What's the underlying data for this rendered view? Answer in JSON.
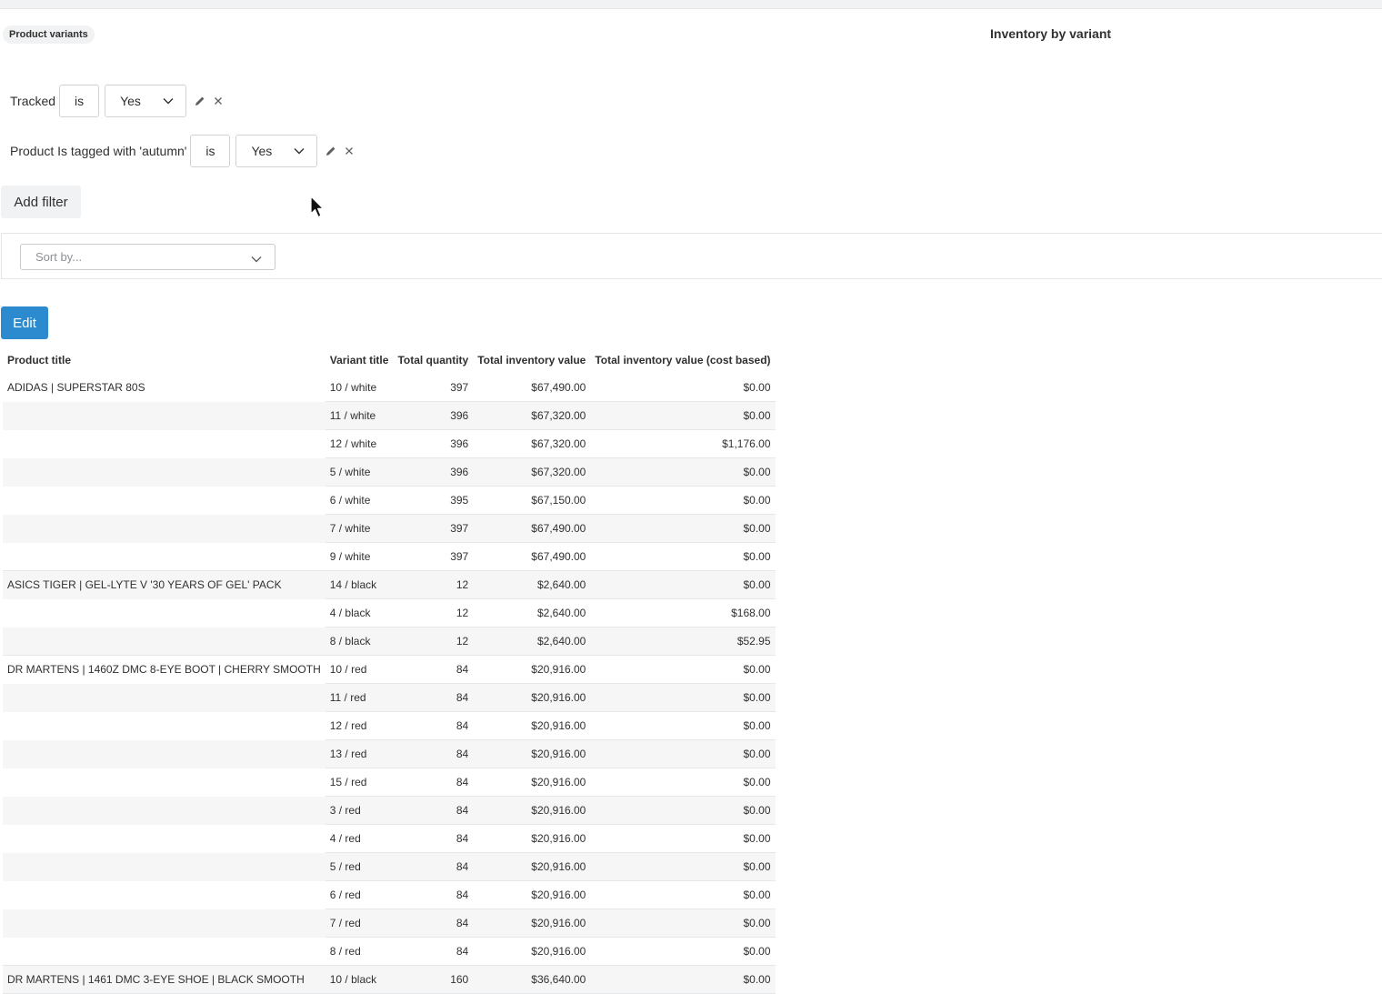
{
  "header": {
    "badge": "Product variants",
    "report_title": "Inventory by variant"
  },
  "filters": [
    {
      "label": "Tracked",
      "operator": "is",
      "value": "Yes"
    },
    {
      "label": "Product Is tagged with 'autumn'",
      "operator": "is",
      "value": "Yes"
    }
  ],
  "actions": {
    "add_filter": "Add filter",
    "edit": "Edit"
  },
  "sort": {
    "placeholder": "Sort by..."
  },
  "table": {
    "columns": [
      "Product title",
      "Variant title",
      "Total quantity",
      "Total inventory value",
      "Total inventory value (cost based)"
    ],
    "rows": [
      [
        "ADIDAS | SUPERSTAR 80S",
        "10 / white",
        "397",
        "$67,490.00",
        "$0.00"
      ],
      [
        "",
        "11 / white",
        "396",
        "$67,320.00",
        "$0.00"
      ],
      [
        "",
        "12 / white",
        "396",
        "$67,320.00",
        "$1,176.00"
      ],
      [
        "",
        "5 / white",
        "396",
        "$67,320.00",
        "$0.00"
      ],
      [
        "",
        "6 / white",
        "395",
        "$67,150.00",
        "$0.00"
      ],
      [
        "",
        "7 / white",
        "397",
        "$67,490.00",
        "$0.00"
      ],
      [
        "",
        "9 / white",
        "397",
        "$67,490.00",
        "$0.00"
      ],
      [
        "ASICS TIGER | GEL-LYTE V '30 YEARS OF GEL' PACK",
        "14 / black",
        "12",
        "$2,640.00",
        "$0.00"
      ],
      [
        "",
        "4 / black",
        "12",
        "$2,640.00",
        "$168.00"
      ],
      [
        "",
        "8 / black",
        "12",
        "$2,640.00",
        "$52.95"
      ],
      [
        "DR MARTENS | 1460Z DMC 8-EYE BOOT | CHERRY SMOOTH",
        "10 / red",
        "84",
        "$20,916.00",
        "$0.00"
      ],
      [
        "",
        "11 / red",
        "84",
        "$20,916.00",
        "$0.00"
      ],
      [
        "",
        "12 / red",
        "84",
        "$20,916.00",
        "$0.00"
      ],
      [
        "",
        "13 / red",
        "84",
        "$20,916.00",
        "$0.00"
      ],
      [
        "",
        "15 / red",
        "84",
        "$20,916.00",
        "$0.00"
      ],
      [
        "",
        "3 / red",
        "84",
        "$20,916.00",
        "$0.00"
      ],
      [
        "",
        "4 / red",
        "84",
        "$20,916.00",
        "$0.00"
      ],
      [
        "",
        "5 / red",
        "84",
        "$20,916.00",
        "$0.00"
      ],
      [
        "",
        "6 / red",
        "84",
        "$20,916.00",
        "$0.00"
      ],
      [
        "",
        "7 / red",
        "84",
        "$20,916.00",
        "$0.00"
      ],
      [
        "",
        "8 / red",
        "84",
        "$20,916.00",
        "$0.00"
      ],
      [
        "DR MARTENS | 1461 DMC 3-EYE SHOE | BLACK SMOOTH",
        "10 / black",
        "160",
        "$36,640.00",
        "$0.00"
      ]
    ]
  },
  "icons": {
    "edit": "pencil-icon",
    "remove": "close-icon",
    "dropdown": "chevron-down-icon",
    "pointer": "mouse-cursor-icon"
  },
  "colors": {
    "primary_button": "#2c8bcf",
    "text": "#303030",
    "badge_bg": "#f1f2f3",
    "alt_row": "#f6f6f7"
  }
}
